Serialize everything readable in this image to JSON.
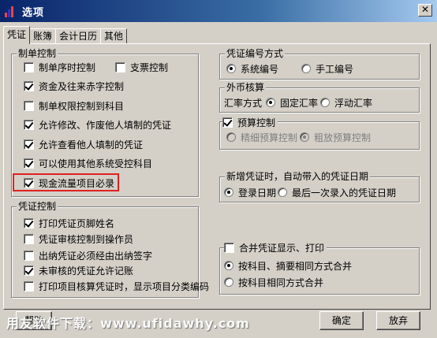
{
  "window": {
    "title": "选项"
  },
  "tabs": [
    "凭证",
    "账簿",
    "会计日历",
    "其他"
  ],
  "left": {
    "zhidan": {
      "title": "制单控制",
      "items": [
        {
          "label": "制单序时控制",
          "checked": false
        },
        {
          "label": "支票控制",
          "checked": false
        },
        {
          "label": "资金及往来赤字控制",
          "checked": true
        },
        {
          "label": "制单权限控制到科目",
          "checked": false
        },
        {
          "label": "允许修改、作废他人填制的凭证",
          "checked": true
        },
        {
          "label": "允许查看他人填制的凭证",
          "checked": true
        },
        {
          "label": "可以使用其他系统受控科目",
          "checked": true
        },
        {
          "label": "现金流量项目必录",
          "checked": true
        }
      ]
    },
    "pingzheng": {
      "title": "凭证控制",
      "items": [
        {
          "label": "打印凭证页脚姓名",
          "checked": true
        },
        {
          "label": "凭证审核控制到操作员",
          "checked": false
        },
        {
          "label": "出纳凭证必须经由出纳签字",
          "checked": false
        },
        {
          "label": "未审核的凭证允许记账",
          "checked": true
        },
        {
          "label": "打印项目核算凭证时，显示项目分类编码",
          "checked": false
        }
      ]
    }
  },
  "right": {
    "bianhao": {
      "title": "凭证编号方式",
      "options": [
        "系统编号",
        "手工编号"
      ],
      "selected": 0
    },
    "waibi": {
      "title": "外币核算",
      "rate_label": "汇率方式",
      "options": [
        "固定汇率",
        "浮动汇率"
      ],
      "selected": 0
    },
    "yusuan": {
      "title": "预算控制",
      "checked": true,
      "options": [
        "精细预算控制",
        "粗放预算控制"
      ],
      "selected": 1
    },
    "riqi": {
      "title": "新增凭证时，自动带入的凭证日期",
      "options": [
        "登录日期",
        "最后一次录入的凭证日期"
      ],
      "selected": 0
    },
    "hebing": {
      "title": "合并凭证显示、打印",
      "checked": false,
      "options": [
        "按科目、摘要相同方式合并",
        "按科目相同方式合并"
      ],
      "selected": 0
    }
  },
  "buttons": {
    "help": "帮助",
    "ok": "确定",
    "cancel": "放弃"
  },
  "watermark": "用友软件下载：www.ufidawhy.com"
}
